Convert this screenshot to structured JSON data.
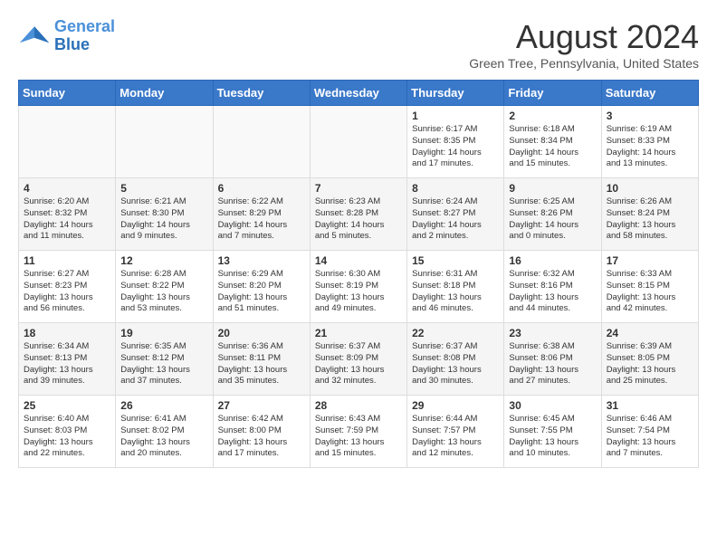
{
  "logo": {
    "line1": "General",
    "line2": "Blue"
  },
  "title": "August 2024",
  "location": "Green Tree, Pennsylvania, United States",
  "weekdays": [
    "Sunday",
    "Monday",
    "Tuesday",
    "Wednesday",
    "Thursday",
    "Friday",
    "Saturday"
  ],
  "weeks": [
    [
      {
        "day": "",
        "info": ""
      },
      {
        "day": "",
        "info": ""
      },
      {
        "day": "",
        "info": ""
      },
      {
        "day": "",
        "info": ""
      },
      {
        "day": "1",
        "info": "Sunrise: 6:17 AM\nSunset: 8:35 PM\nDaylight: 14 hours\nand 17 minutes."
      },
      {
        "day": "2",
        "info": "Sunrise: 6:18 AM\nSunset: 8:34 PM\nDaylight: 14 hours\nand 15 minutes."
      },
      {
        "day": "3",
        "info": "Sunrise: 6:19 AM\nSunset: 8:33 PM\nDaylight: 14 hours\nand 13 minutes."
      }
    ],
    [
      {
        "day": "4",
        "info": "Sunrise: 6:20 AM\nSunset: 8:32 PM\nDaylight: 14 hours\nand 11 minutes."
      },
      {
        "day": "5",
        "info": "Sunrise: 6:21 AM\nSunset: 8:30 PM\nDaylight: 14 hours\nand 9 minutes."
      },
      {
        "day": "6",
        "info": "Sunrise: 6:22 AM\nSunset: 8:29 PM\nDaylight: 14 hours\nand 7 minutes."
      },
      {
        "day": "7",
        "info": "Sunrise: 6:23 AM\nSunset: 8:28 PM\nDaylight: 14 hours\nand 5 minutes."
      },
      {
        "day": "8",
        "info": "Sunrise: 6:24 AM\nSunset: 8:27 PM\nDaylight: 14 hours\nand 2 minutes."
      },
      {
        "day": "9",
        "info": "Sunrise: 6:25 AM\nSunset: 8:26 PM\nDaylight: 14 hours\nand 0 minutes."
      },
      {
        "day": "10",
        "info": "Sunrise: 6:26 AM\nSunset: 8:24 PM\nDaylight: 13 hours\nand 58 minutes."
      }
    ],
    [
      {
        "day": "11",
        "info": "Sunrise: 6:27 AM\nSunset: 8:23 PM\nDaylight: 13 hours\nand 56 minutes."
      },
      {
        "day": "12",
        "info": "Sunrise: 6:28 AM\nSunset: 8:22 PM\nDaylight: 13 hours\nand 53 minutes."
      },
      {
        "day": "13",
        "info": "Sunrise: 6:29 AM\nSunset: 8:20 PM\nDaylight: 13 hours\nand 51 minutes."
      },
      {
        "day": "14",
        "info": "Sunrise: 6:30 AM\nSunset: 8:19 PM\nDaylight: 13 hours\nand 49 minutes."
      },
      {
        "day": "15",
        "info": "Sunrise: 6:31 AM\nSunset: 8:18 PM\nDaylight: 13 hours\nand 46 minutes."
      },
      {
        "day": "16",
        "info": "Sunrise: 6:32 AM\nSunset: 8:16 PM\nDaylight: 13 hours\nand 44 minutes."
      },
      {
        "day": "17",
        "info": "Sunrise: 6:33 AM\nSunset: 8:15 PM\nDaylight: 13 hours\nand 42 minutes."
      }
    ],
    [
      {
        "day": "18",
        "info": "Sunrise: 6:34 AM\nSunset: 8:13 PM\nDaylight: 13 hours\nand 39 minutes."
      },
      {
        "day": "19",
        "info": "Sunrise: 6:35 AM\nSunset: 8:12 PM\nDaylight: 13 hours\nand 37 minutes."
      },
      {
        "day": "20",
        "info": "Sunrise: 6:36 AM\nSunset: 8:11 PM\nDaylight: 13 hours\nand 35 minutes."
      },
      {
        "day": "21",
        "info": "Sunrise: 6:37 AM\nSunset: 8:09 PM\nDaylight: 13 hours\nand 32 minutes."
      },
      {
        "day": "22",
        "info": "Sunrise: 6:37 AM\nSunset: 8:08 PM\nDaylight: 13 hours\nand 30 minutes."
      },
      {
        "day": "23",
        "info": "Sunrise: 6:38 AM\nSunset: 8:06 PM\nDaylight: 13 hours\nand 27 minutes."
      },
      {
        "day": "24",
        "info": "Sunrise: 6:39 AM\nSunset: 8:05 PM\nDaylight: 13 hours\nand 25 minutes."
      }
    ],
    [
      {
        "day": "25",
        "info": "Sunrise: 6:40 AM\nSunset: 8:03 PM\nDaylight: 13 hours\nand 22 minutes."
      },
      {
        "day": "26",
        "info": "Sunrise: 6:41 AM\nSunset: 8:02 PM\nDaylight: 13 hours\nand 20 minutes."
      },
      {
        "day": "27",
        "info": "Sunrise: 6:42 AM\nSunset: 8:00 PM\nDaylight: 13 hours\nand 17 minutes."
      },
      {
        "day": "28",
        "info": "Sunrise: 6:43 AM\nSunset: 7:59 PM\nDaylight: 13 hours\nand 15 minutes."
      },
      {
        "day": "29",
        "info": "Sunrise: 6:44 AM\nSunset: 7:57 PM\nDaylight: 13 hours\nand 12 minutes."
      },
      {
        "day": "30",
        "info": "Sunrise: 6:45 AM\nSunset: 7:55 PM\nDaylight: 13 hours\nand 10 minutes."
      },
      {
        "day": "31",
        "info": "Sunrise: 6:46 AM\nSunset: 7:54 PM\nDaylight: 13 hours\nand 7 minutes."
      }
    ]
  ]
}
